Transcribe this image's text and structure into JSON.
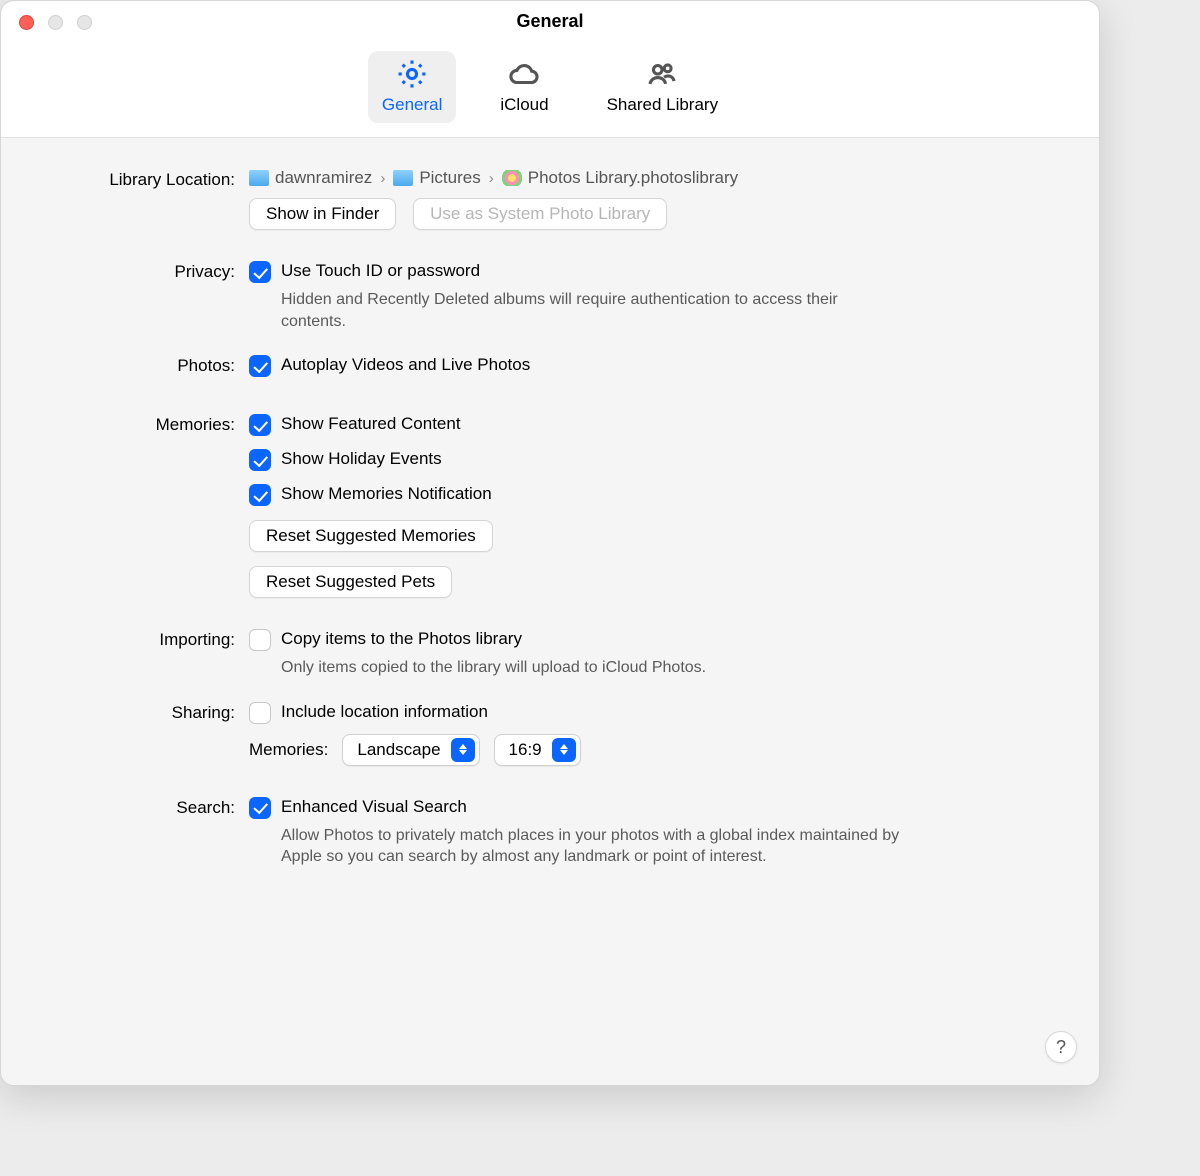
{
  "window": {
    "title": "General"
  },
  "tabs": {
    "general": "General",
    "icloud": "iCloud",
    "shared": "Shared Library"
  },
  "library": {
    "label": "Library Location:",
    "path": [
      "dawnramirez",
      "Pictures",
      "Photos Library.photoslibrary"
    ],
    "show_in_finder": "Show in Finder",
    "use_system": "Use as System Photo Library"
  },
  "privacy": {
    "label": "Privacy:",
    "touchid": "Use Touch ID or password",
    "touchid_sub": "Hidden and Recently Deleted albums will require authentication to access their contents."
  },
  "photos": {
    "label": "Photos:",
    "autoplay": "Autoplay Videos and Live Photos"
  },
  "memories": {
    "label": "Memories:",
    "featured": "Show Featured Content",
    "holiday": "Show Holiday Events",
    "notify": "Show Memories Notification",
    "reset_memories": "Reset Suggested Memories",
    "reset_pets": "Reset Suggested Pets"
  },
  "importing": {
    "label": "Importing:",
    "copy": "Copy items to the Photos library",
    "copy_sub": "Only items copied to the library will upload to iCloud Photos."
  },
  "sharing": {
    "label": "Sharing:",
    "location": "Include location information",
    "memories_label": "Memories:",
    "orientation": "Landscape",
    "aspect": "16:9"
  },
  "search": {
    "label": "Search:",
    "evs": "Enhanced Visual Search",
    "evs_sub": "Allow Photos to privately match places in your photos with a global index maintained by Apple so you can search by almost any landmark or point of interest."
  },
  "help": "?"
}
